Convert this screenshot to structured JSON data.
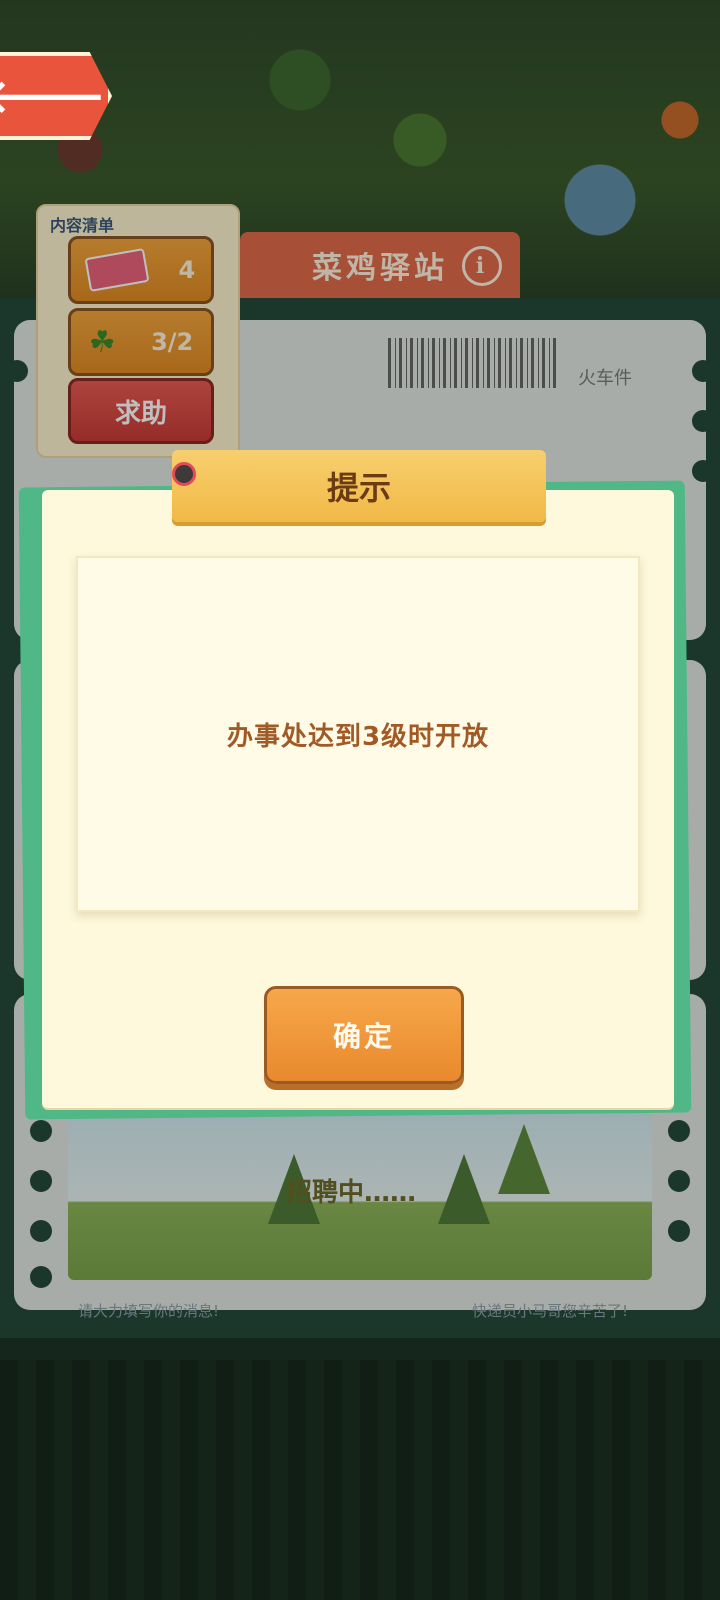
{
  "back": {
    "arrow": "🡐"
  },
  "station": {
    "title": "菜鸡驿站",
    "info_icon": "i",
    "train_label": "火车件",
    "recruit_text": "招聘中……",
    "footer_left": "请大力填写你的消息!",
    "footer_right": "快递员小马哥您辛苦了!"
  },
  "contents": {
    "title": "内容清单",
    "tickets_count": "4",
    "sprouts_progress": "3/2",
    "help_label": "求助"
  },
  "dialog": {
    "title": "提示",
    "message": "办事处达到3级时开放",
    "confirm_label": "确定"
  },
  "colors": {
    "confirm_button": "#e9892d",
    "help_button": "#c93b36",
    "dialog_bg": "#fef8dc",
    "dialog_accent": "#4fb886"
  }
}
